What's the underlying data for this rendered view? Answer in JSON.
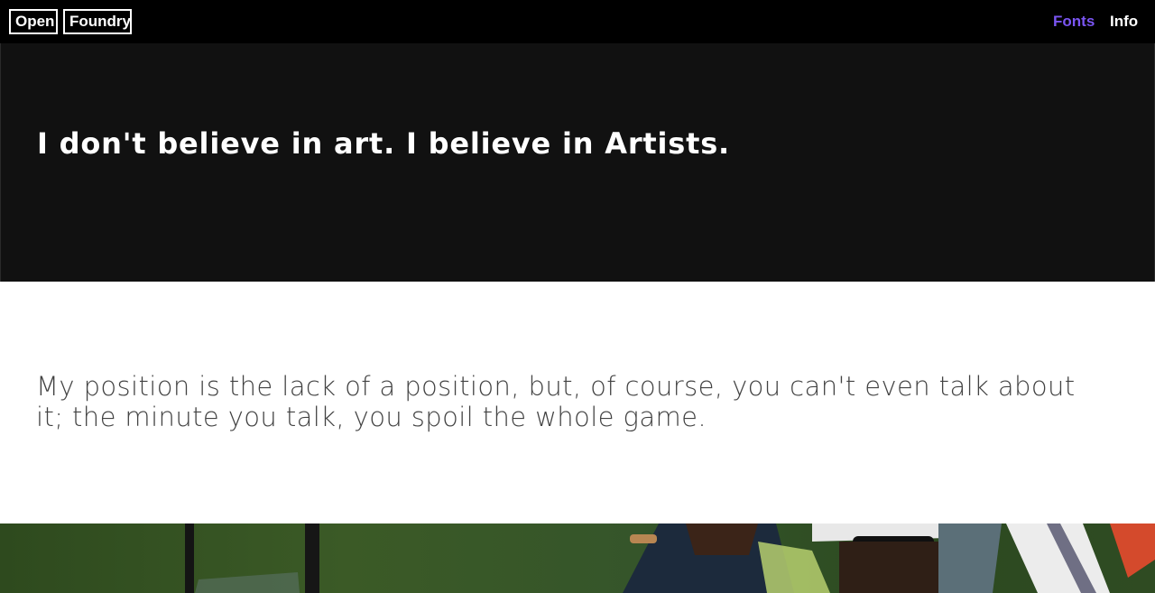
{
  "header": {
    "logo": [
      "Open",
      "Foundry"
    ],
    "nav": [
      {
        "label": "Fonts",
        "active": true
      },
      {
        "label": "Info",
        "active": false
      }
    ],
    "accent_color": "#7a55f2"
  },
  "hero": {
    "title": "I don't believe in art. I believe in Artists."
  },
  "quote": {
    "text": "My position is the lack of a position, but, of course, you can't even talk about it; the minute you talk, you spoil the whole game."
  }
}
